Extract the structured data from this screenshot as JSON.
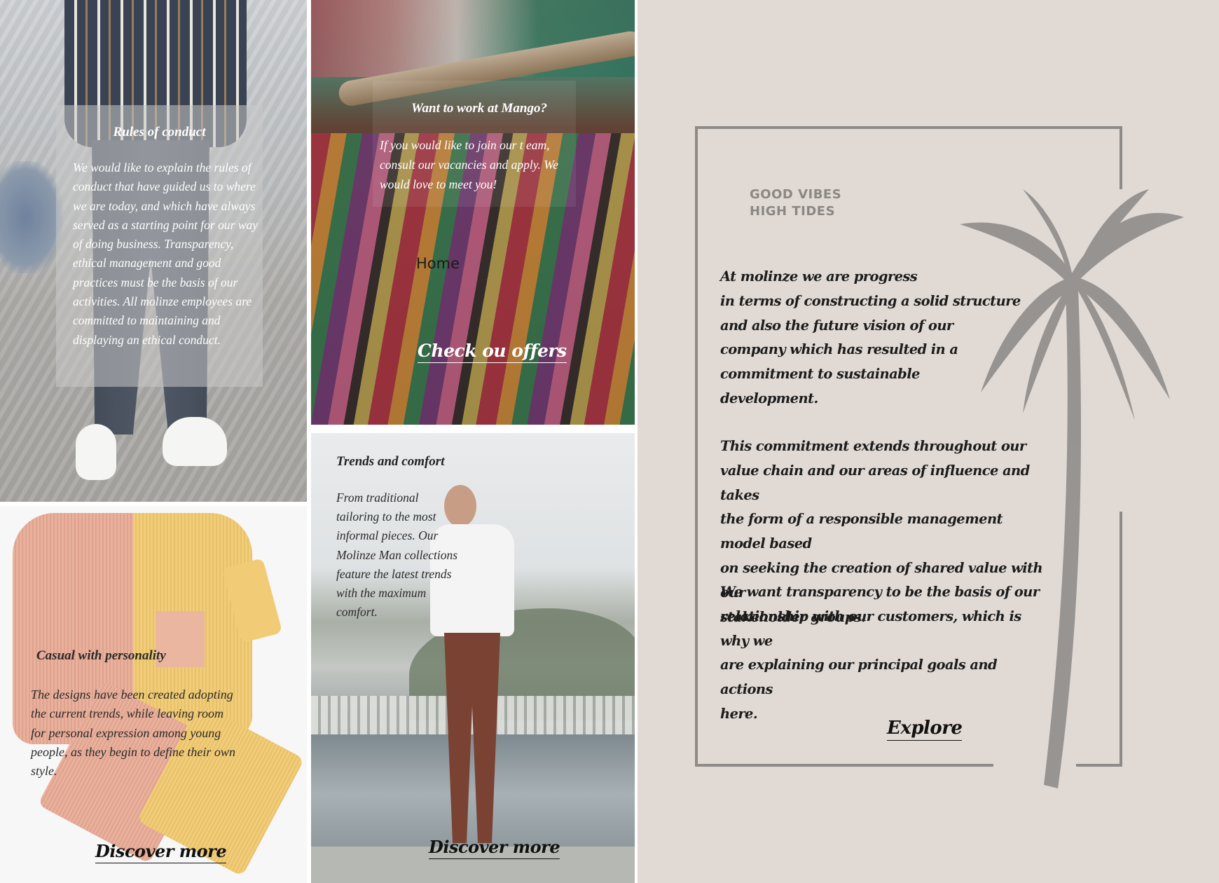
{
  "rules_panel": {
    "title": "Rules of conduct",
    "body": "We would like to explain the rules of conduct that have guided us to where we are today, and which have always served as a starting point for our way of doing business. Transparency, ethical management and good practices must be the basis of our activities. All molinze employees are committed to maintaining and displaying an ethical conduct."
  },
  "work_panel": {
    "title": "Want to work at Mango?",
    "body": "If you would like to join our t eam, consult our vacancies and apply. We would love to meet you!",
    "home_link": "Home",
    "cta": "Check ou offers"
  },
  "trends_panel": {
    "title": "Trends and comfort",
    "body": "From traditional tailoring to the most informal pieces. Our Molinze Man collections feature the latest trends with the maximum comfort.",
    "cta": "Discover more"
  },
  "casual_panel": {
    "title": "Casual with personality",
    "body": "The designs have been created adopting the current trends, while leaving room for personal expression among young people, as they begin to define their own style.",
    "cta": "Discover more"
  },
  "vibes_panel": {
    "tagline_line1": "GOOD VIBES",
    "tagline_line2": "HIGH TIDES",
    "paragraph1": "At molinze we are progress\nin terms of constructing a solid structure\nand also the future vision of our\ncompany which has resulted in a\ncommitment to sustainable\ndevelopment.",
    "paragraph2": "This commitment extends throughout our\nvalue chain and our areas of influence and takes\nthe form of a responsible management model based\non seeking the creation of shared value with our\nstakeholder groups.",
    "paragraph3": "We want transparency to be the basis of our\nrelationship with our customers, which is why we\nare explaining our principal goals and actions\nhere.",
    "cta": "Explore"
  },
  "colors": {
    "beige_background": "#e1dad4",
    "frame_gray": "#8d8a88",
    "palm_gray": "#8a8786"
  },
  "icons": [
    "palm-tree-icon"
  ]
}
